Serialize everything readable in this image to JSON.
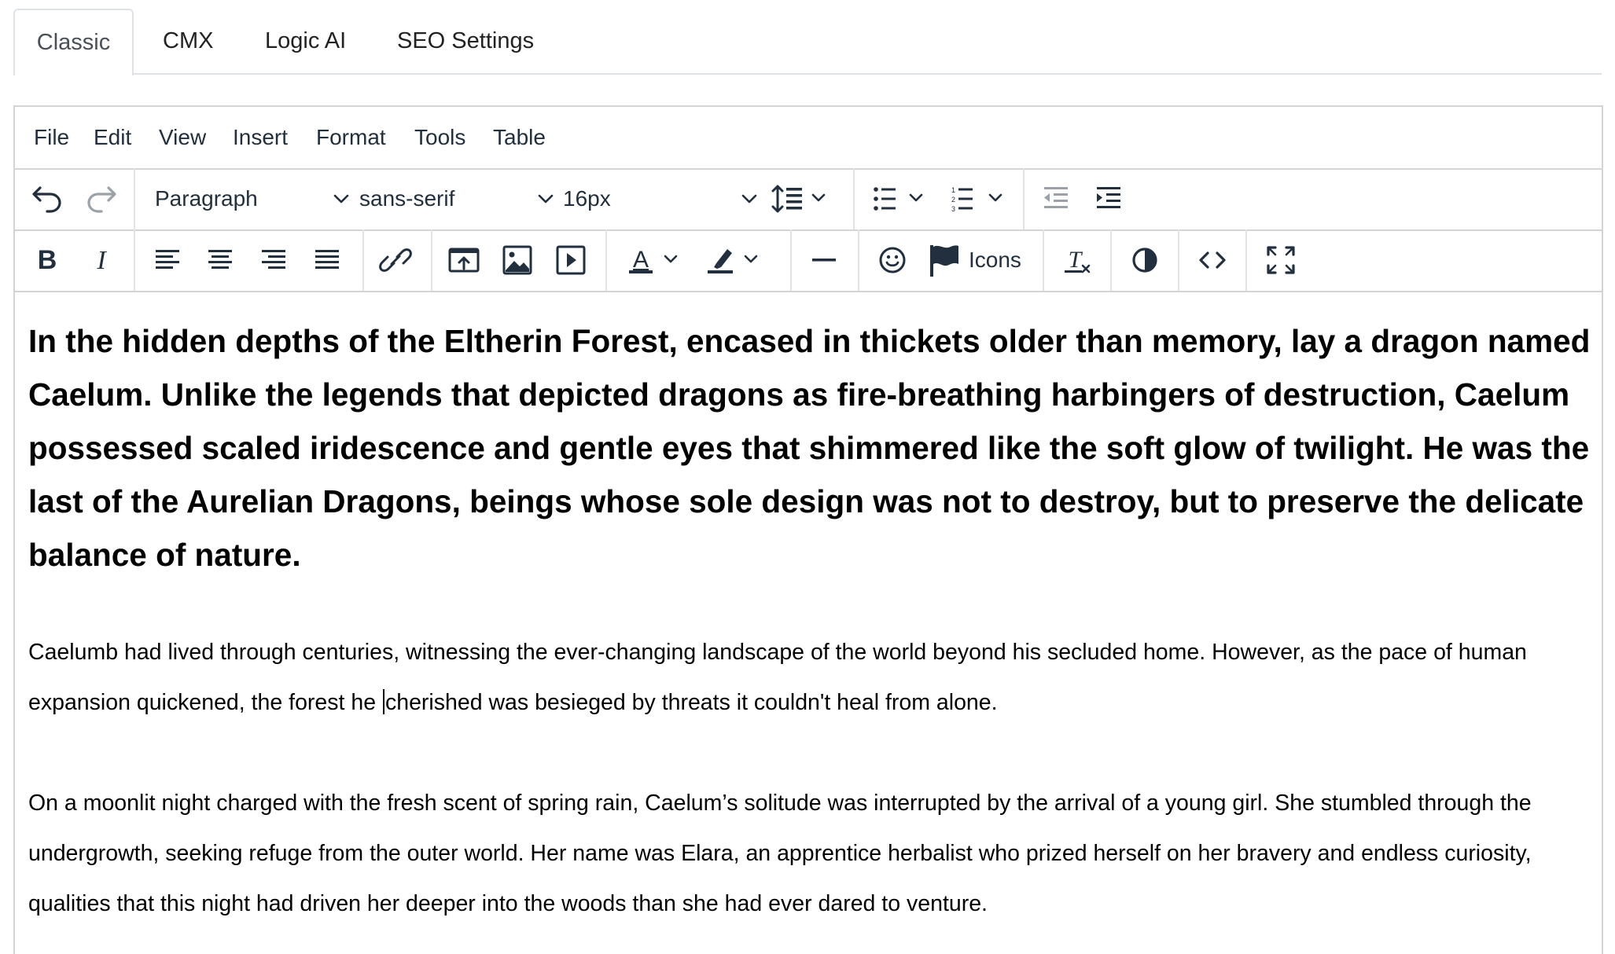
{
  "tabs": [
    {
      "label": "Classic",
      "active": true
    },
    {
      "label": "CMX",
      "active": false
    },
    {
      "label": "Logic AI",
      "active": false
    },
    {
      "label": "SEO Settings",
      "active": false
    }
  ],
  "menubar": {
    "items": [
      "File",
      "Edit",
      "View",
      "Insert",
      "Format",
      "Tools",
      "Table"
    ]
  },
  "toolbar": {
    "block_format": "Paragraph",
    "font_family": "sans-serif",
    "font_size": "16px",
    "icons_label": "Icons",
    "icons": [
      "undo-icon",
      "redo-icon",
      "line-height-icon",
      "bullet-list-icon",
      "numbered-list-icon",
      "outdent-icon",
      "indent-icon",
      "bold-icon",
      "italic-icon",
      "align-left-icon",
      "align-center-icon",
      "align-right-icon",
      "align-justify-icon",
      "link-icon",
      "upload-icon",
      "image-icon",
      "media-icon",
      "text-color-icon",
      "highlight-icon",
      "horizontal-rule-icon",
      "emoji-icon",
      "flag-icon",
      "clear-formatting-icon",
      "contrast-icon",
      "code-icon",
      "fullscreen-icon"
    ]
  },
  "content": {
    "heading": "In the hidden depths of the Eltherin Forest, encased in thickets older than memory, lay a dragon named Caelum. Unlike the legends that depicted dragons as fire-breathing harbingers of destruction, Caelum possessed scaled iridescence and gentle eyes that shimmered like the soft glow of twilight. He was the last of the Aurelian Dragons, beings whose sole design was not to destroy, but to preserve the delicate balance of nature.",
    "paragraph1_before_caret": "Caelumb had lived through centuries, witnessing the ever-changing landscape of the world beyond his secluded home. However, as the pace of human expansion quickened, the forest he ",
    "paragraph1_after_caret": "cherished was besieged by threats it couldn't heal from alone.",
    "paragraph2": "On a moonlit night charged with the fresh scent of spring rain, Caelum’s solitude was interrupted by the arrival of a young girl. She stumbled through the undergrowth, seeking refuge from the outer world. Her name was Elara, an apprentice herbalist who prized herself on her bravery and endless curiosity, qualities that this night had driven her deeper into the woods than she had ever dared to venture."
  },
  "colors": {
    "border": "#d4d4d4",
    "icon": "#222f3e",
    "tab_border": "#dee2e6"
  }
}
